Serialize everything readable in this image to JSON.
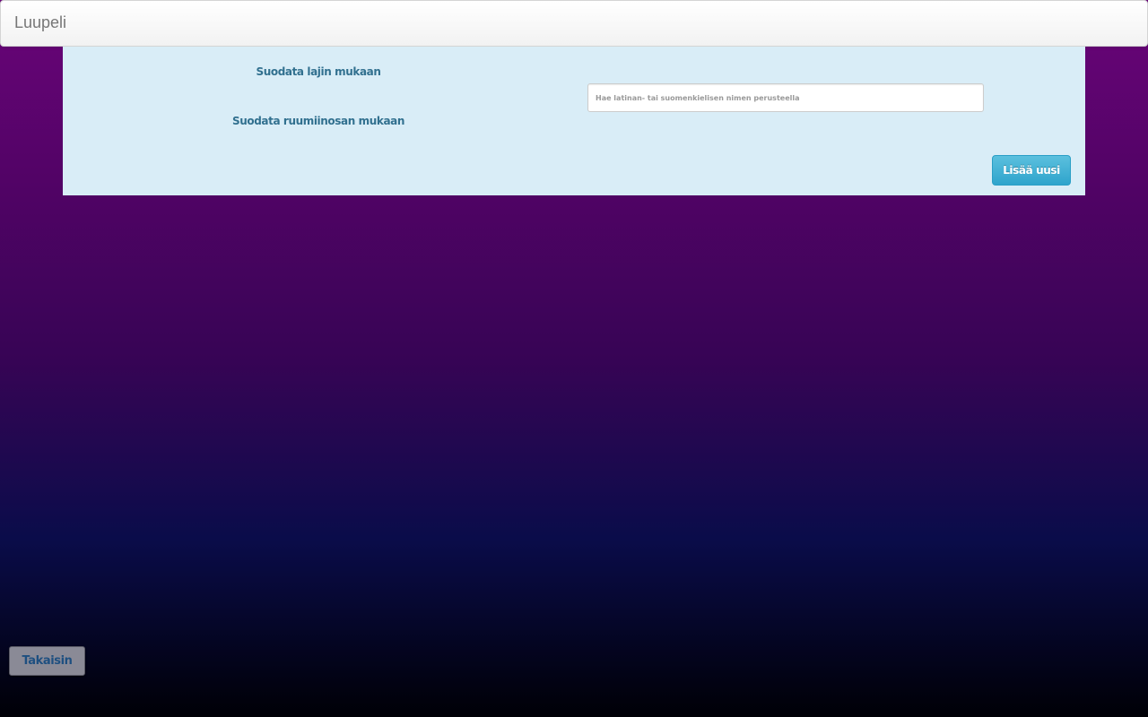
{
  "navbar": {
    "brand": "Luupeli"
  },
  "filters": {
    "species_label": "Suodata lajin mukaan",
    "bodypart_label": "Suodata ruumiinosan mukaan"
  },
  "search": {
    "value": "",
    "placeholder": "Hae latinan- tai suomenkielisen nimen perusteella"
  },
  "actions": {
    "add_new_label": "Lisää uusi",
    "back_label": "Takaisin"
  },
  "colors": {
    "panel_background": "#d9edf7",
    "label_text": "#31708f",
    "add_button": "#5bc0de",
    "back_button": "#8a8a96",
    "background_top": "#6a0479",
    "background_bottom": "#000006"
  }
}
